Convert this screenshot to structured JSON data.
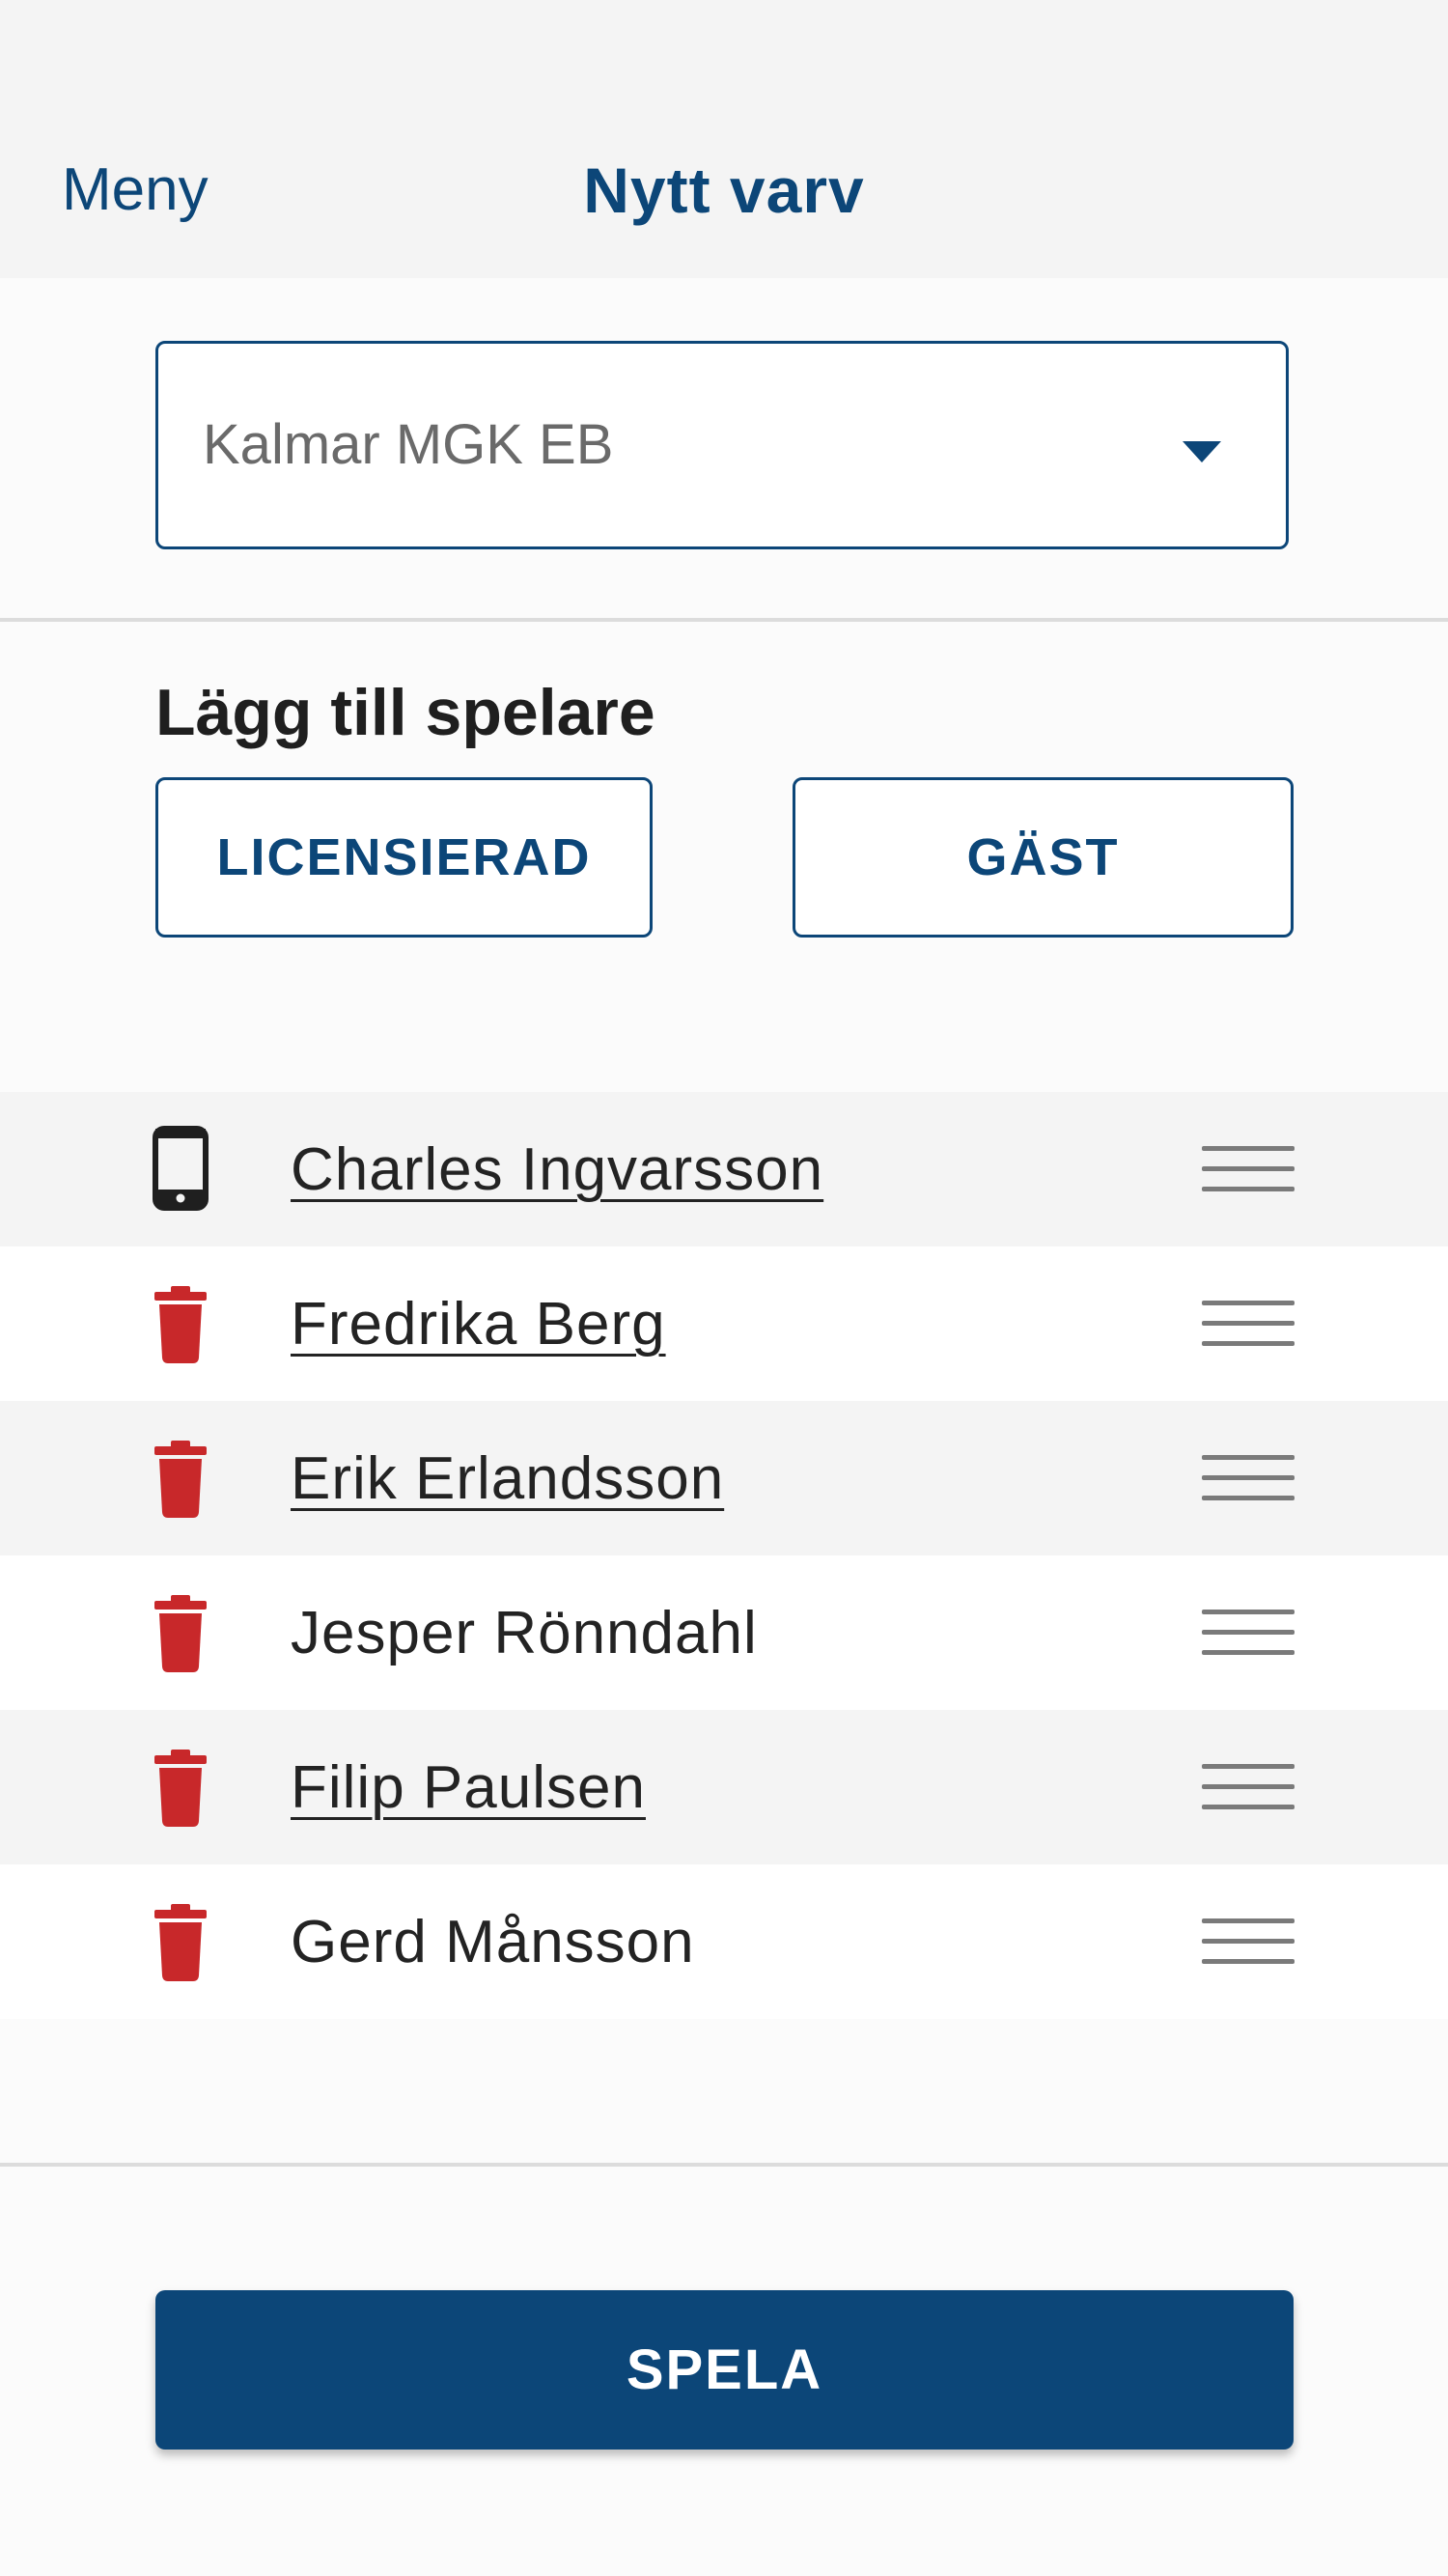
{
  "header": {
    "menu_label": "Meny",
    "title": "Nytt varv"
  },
  "course_select": {
    "selected_value": "Kalmar MGK EB",
    "icon": "caret-down-icon"
  },
  "add_players": {
    "heading": "Lägg till spelare",
    "licensed_button_label": "LICENSIERAD",
    "guest_button_label": "GÄST"
  },
  "players": [
    {
      "name": "Charles Ingvarsson",
      "icon": "phone-icon",
      "linked": true
    },
    {
      "name": "Fredrika Berg",
      "icon": "trash-icon",
      "linked": true
    },
    {
      "name": "Erik Erlandsson",
      "icon": "trash-icon",
      "linked": true
    },
    {
      "name": "Jesper Rönndahl",
      "icon": "trash-icon",
      "linked": false
    },
    {
      "name": "Filip Paulsen",
      "icon": "trash-icon",
      "linked": true
    },
    {
      "name": "Gerd Månsson",
      "icon": "trash-icon",
      "linked": false
    }
  ],
  "footer": {
    "play_button_label": "SPELA"
  },
  "colors": {
    "brand_blue": "#0c4678",
    "delete_red": "#c8282a",
    "row_shade": "#f4f4f4"
  }
}
